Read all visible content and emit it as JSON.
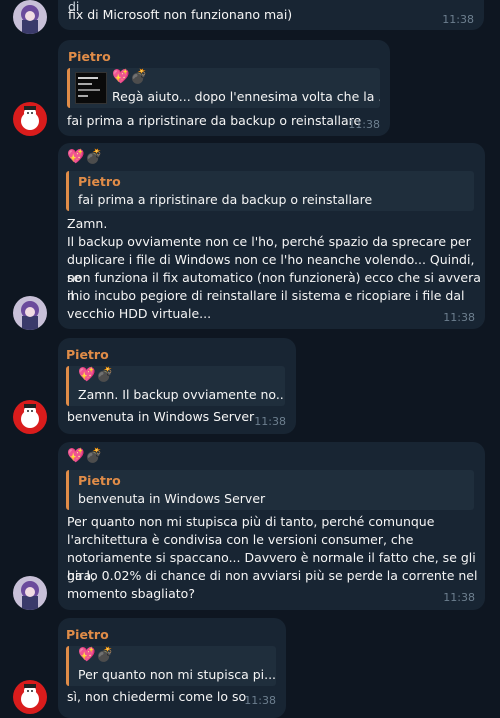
{
  "messages": [
    {
      "lines": [
        "chiedevo prima se davvero funzionerà, perché spesso le istruzioni di",
        "fix di Microsoft non funzionano mai)"
      ],
      "time": "11:38"
    },
    {
      "sender": "Pietro",
      "reply_emoji": "💖💣",
      "reply_text": "Regà aiuto... dopo l'ennesima volta che la ...",
      "text": "fai prima a ripristinare da backup o reinstallare",
      "time": "11:38"
    },
    {
      "emoji": "💖💣",
      "reply_sender": "Pietro",
      "reply_text": "fai prima a ripristinare da backup o reinstallare",
      "lines": [
        "Zamn.",
        "Il backup ovviamente non ce l'ho, perché spazio da sprecare per",
        "duplicare i file di Windows non ce l'ho neanche volendo... Quindi, se",
        "non funziona il fix automatico (non funzionerà) ecco che si avvera il",
        "mio incubo pegiore di reinstallare il sistema e ricopiare i file dal",
        "vecchio HDD virtuale..."
      ],
      "time": "11:38"
    },
    {
      "sender": "Pietro",
      "reply_emoji": "💖💣",
      "reply_text": "Zamn. Il backup ovviamente no...",
      "text": "benvenuta in Windows Server",
      "time": "11:38"
    },
    {
      "emoji": "💖💣",
      "reply_sender": "Pietro",
      "reply_text": "benvenuta in Windows Server",
      "lines": [
        "Per quanto non mi stupisca più di tanto, perché comunque",
        "l'architettura è condivisa con le versioni consumer, che",
        "notoriamente si spaccano... Davvero è normale il fatto che, se gli gira,",
        "ha lo 0.02% di chance di non avviarsi più se perde la corrente nel",
        "momento sbagliato?"
      ],
      "time": "11:38"
    },
    {
      "sender": "Pietro",
      "reply_emoji": "💖💣",
      "reply_text": "Per quanto non mi stupisca pi...",
      "text": "sì, non chiedermi come lo so",
      "time": "11:38"
    }
  ]
}
